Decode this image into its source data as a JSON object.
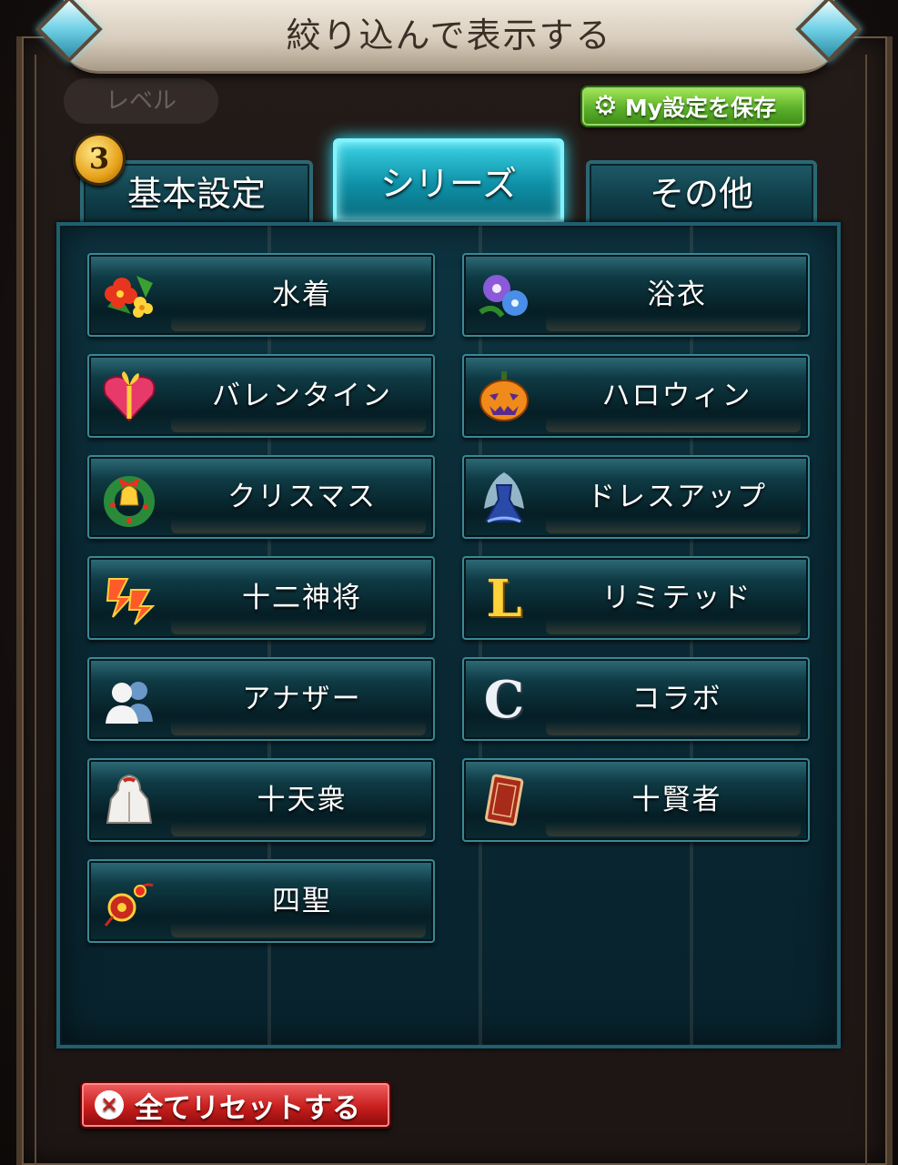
{
  "header": {
    "title": "絞り込んで表示する"
  },
  "background": {
    "level_tab": "レベル"
  },
  "save_button": {
    "label": "My設定を保存",
    "icon": "gear-icon"
  },
  "tabs": [
    {
      "label": "基本設定",
      "active": false,
      "badge": "3"
    },
    {
      "label": "シリーズ",
      "active": true
    },
    {
      "label": "その他",
      "active": false
    }
  ],
  "series": [
    {
      "label": "水着",
      "icon": "hibiscus-icon"
    },
    {
      "label": "浴衣",
      "icon": "morning-glory-icon"
    },
    {
      "label": "バレンタイン",
      "icon": "heart-box-icon"
    },
    {
      "label": "ハロウィン",
      "icon": "pumpkin-icon"
    },
    {
      "label": "クリスマス",
      "icon": "wreath-icon"
    },
    {
      "label": "ドレスアップ",
      "icon": "dress-icon"
    },
    {
      "label": "十二神将",
      "icon": "zodiac-icon"
    },
    {
      "label": "リミテッド",
      "icon": "limited-l-icon"
    },
    {
      "label": "アナザー",
      "icon": "two-people-icon"
    },
    {
      "label": "コラボ",
      "icon": "collab-c-icon"
    },
    {
      "label": "十天衆",
      "icon": "white-robe-icon"
    },
    {
      "label": "十賢者",
      "icon": "red-card-icon"
    },
    {
      "label": "四聖",
      "icon": "ornament-icon"
    }
  ],
  "reset_button": {
    "label": "全てリセットする",
    "icon": "close-circle-icon"
  },
  "colors": {
    "accent": "#2fe6ff",
    "save": "#5cb02a",
    "reset": "#c81e1e"
  }
}
